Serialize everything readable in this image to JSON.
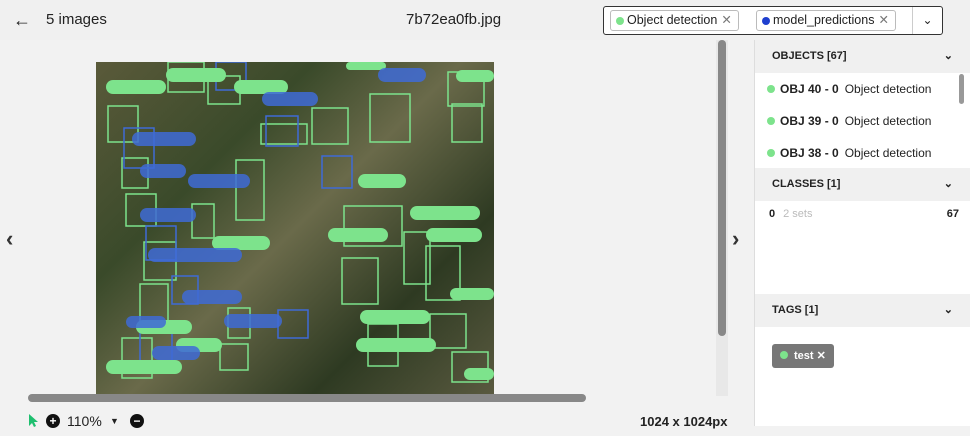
{
  "header": {
    "back_icon": "arrow-left-icon",
    "image_count": "5 images",
    "filename": "7b72ea0fb.jpg",
    "filters": [
      {
        "label": "Object detection",
        "color": "#7de38c"
      },
      {
        "label": "model_predictions",
        "color": "#1f3fcf"
      }
    ]
  },
  "viewer": {
    "zoom": "110%",
    "dimensions": "1024 x 1024px"
  },
  "panel": {
    "objects_header": "OBJECTS [67]",
    "objects": [
      {
        "id": "OBJ 40 - 0",
        "label": "Object detection"
      },
      {
        "id": "OBJ 39 - 0",
        "label": "Object detection"
      },
      {
        "id": "OBJ 38 - 0",
        "label": "Object detection"
      }
    ],
    "classes_header": "CLASSES [1]",
    "class_row": {
      "name": "0",
      "sets": "2 sets",
      "count": "67"
    },
    "tags_header": "TAGS [1]",
    "tag": "test"
  },
  "colors": {
    "gt": "#7de38c",
    "pred": "#3f6bd6"
  }
}
